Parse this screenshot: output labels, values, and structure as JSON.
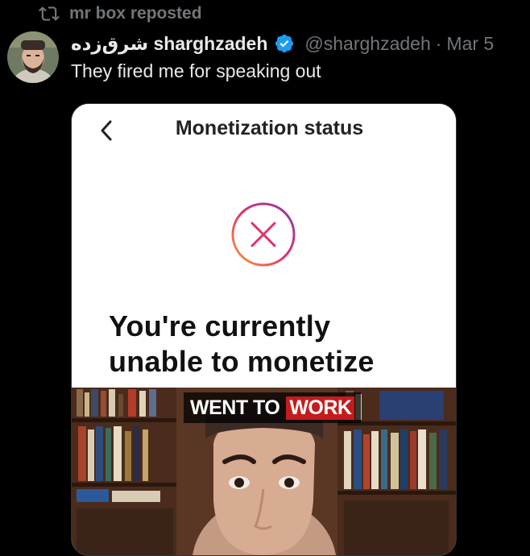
{
  "repost": {
    "icon": "repost-icon",
    "text": "mr box reposted"
  },
  "author": {
    "display_name": "شرق‌زده sharghzadeh",
    "verified": true,
    "verified_icon": "verified-badge-icon",
    "handle": "@sharghzadeh",
    "separator": "·",
    "date": "Mar 5",
    "avatar": "avatar"
  },
  "tweet": {
    "text": "They fired me for speaking out"
  },
  "media": {
    "screen_title": "Monetization status",
    "back_icon": "chevron-left-icon",
    "status_icon": "x-circle-icon",
    "headline_line1": "You're currently",
    "headline_line2": "unable to monetize",
    "caption_part1": "WENT TO",
    "caption_part2": "WORK"
  },
  "colors": {
    "background": "#000000",
    "text_primary": "#e7e9ea",
    "text_secondary": "#71767b",
    "verified_blue": "#1d9bf0",
    "caption_red": "#c41c1c"
  }
}
